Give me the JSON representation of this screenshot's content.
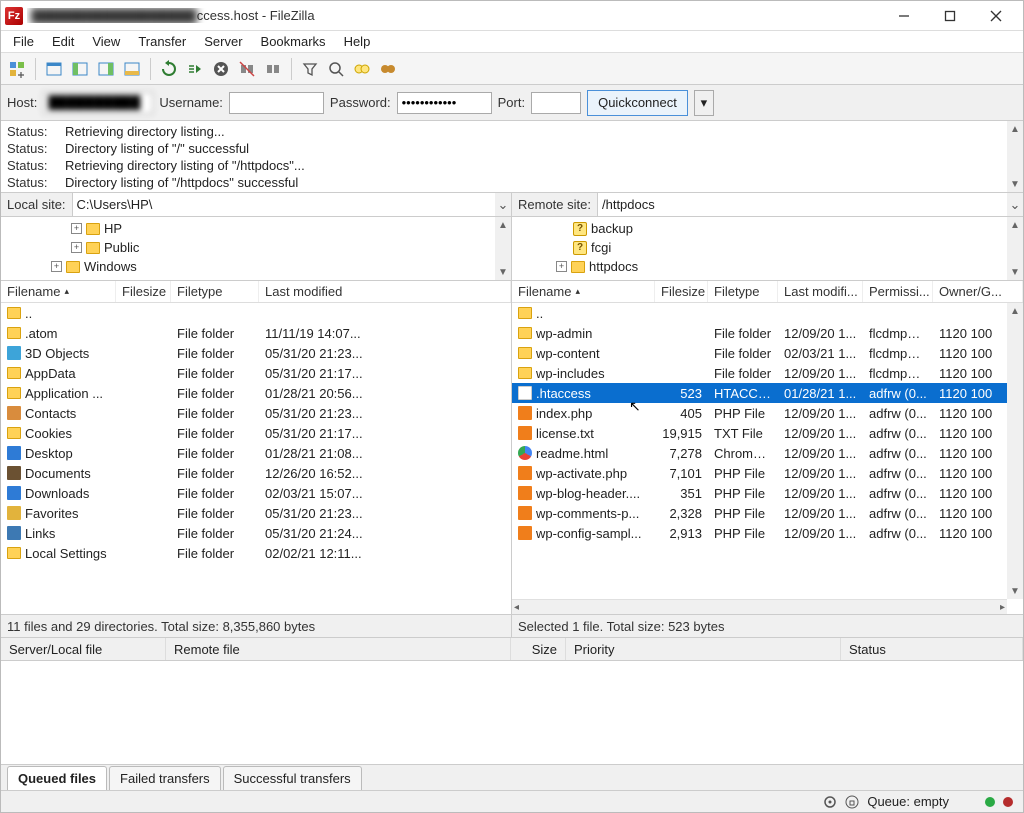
{
  "title": {
    "obscured": "██████████████████",
    "suffix": "ccess.host - FileZilla"
  },
  "menu": [
    "File",
    "Edit",
    "View",
    "Transfer",
    "Server",
    "Bookmarks",
    "Help"
  ],
  "quick": {
    "host_label": "Host:",
    "host_value": "██████████",
    "user_label": "Username:",
    "user_value": "",
    "pass_label": "Password:",
    "pass_value": "••••••••••••",
    "port_label": "Port:",
    "port_value": "",
    "connect": "Quickconnect"
  },
  "log": [
    {
      "k": "Status:",
      "t": "Retrieving directory listing..."
    },
    {
      "k": "Status:",
      "t": "Directory listing of \"/\" successful"
    },
    {
      "k": "Status:",
      "t": "Retrieving directory listing of \"/httpdocs\"..."
    },
    {
      "k": "Status:",
      "t": "Directory listing of \"/httpdocs\" successful"
    }
  ],
  "local": {
    "site_label": "Local site:",
    "site_value": "C:\\Users\\HP\\",
    "tree": [
      "HP",
      "Public",
      "Windows"
    ],
    "headers": {
      "name": "Filename",
      "size": "Filesize",
      "type": "Filetype",
      "mod": "Last modified"
    },
    "rows": [
      {
        "icon": "folder",
        "name": "..",
        "size": "",
        "type": "",
        "mod": ""
      },
      {
        "icon": "folder",
        "name": ".atom",
        "size": "",
        "type": "File folder",
        "mod": "11/11/19 14:07..."
      },
      {
        "icon": "obj3d",
        "name": "3D Objects",
        "size": "",
        "type": "File folder",
        "mod": "05/31/20 21:23..."
      },
      {
        "icon": "folder",
        "name": "AppData",
        "size": "",
        "type": "File folder",
        "mod": "05/31/20 21:17..."
      },
      {
        "icon": "folder",
        "name": "Application ...",
        "size": "",
        "type": "File folder",
        "mod": "01/28/21 20:56..."
      },
      {
        "icon": "contacts",
        "name": "Contacts",
        "size": "",
        "type": "File folder",
        "mod": "05/31/20 21:23..."
      },
      {
        "icon": "folder",
        "name": "Cookies",
        "size": "",
        "type": "File folder",
        "mod": "05/31/20 21:17..."
      },
      {
        "icon": "desktop",
        "name": "Desktop",
        "size": "",
        "type": "File folder",
        "mod": "01/28/21 21:08..."
      },
      {
        "icon": "docs",
        "name": "Documents",
        "size": "",
        "type": "File folder",
        "mod": "12/26/20 16:52..."
      },
      {
        "icon": "downloads",
        "name": "Downloads",
        "size": "",
        "type": "File folder",
        "mod": "02/03/21 15:07..."
      },
      {
        "icon": "fav",
        "name": "Favorites",
        "size": "",
        "type": "File folder",
        "mod": "05/31/20 21:23..."
      },
      {
        "icon": "links",
        "name": "Links",
        "size": "",
        "type": "File folder",
        "mod": "05/31/20 21:24..."
      },
      {
        "icon": "folder",
        "name": "Local Settings",
        "size": "",
        "type": "File folder",
        "mod": "02/02/21 12:11..."
      }
    ],
    "status": "11 files and 29 directories. Total size: 8,355,860 bytes"
  },
  "remote": {
    "site_label": "Remote site:",
    "site_value": "/httpdocs",
    "tree": [
      {
        "icon": "q",
        "name": "backup",
        "expander": ""
      },
      {
        "icon": "q",
        "name": "fcgi",
        "expander": ""
      },
      {
        "icon": "folder",
        "name": "httpdocs",
        "expander": "+"
      }
    ],
    "headers": {
      "name": "Filename",
      "size": "Filesize",
      "type": "Filetype",
      "mod": "Last modifi...",
      "perm": "Permissi...",
      "owner": "Owner/G..."
    },
    "rows": [
      {
        "icon": "folder",
        "name": "..",
        "size": "",
        "type": "",
        "mod": "",
        "perm": "",
        "owner": "",
        "sel": false
      },
      {
        "icon": "folder",
        "name": "wp-admin",
        "size": "",
        "type": "File folder",
        "mod": "12/09/20 1...",
        "perm": "flcdmpe ...",
        "owner": "1120 100",
        "sel": false
      },
      {
        "icon": "folder",
        "name": "wp-content",
        "size": "",
        "type": "File folder",
        "mod": "02/03/21 1...",
        "perm": "flcdmpe ...",
        "owner": "1120 100",
        "sel": false
      },
      {
        "icon": "folder",
        "name": "wp-includes",
        "size": "",
        "type": "File folder",
        "mod": "12/09/20 1...",
        "perm": "flcdmpe ...",
        "owner": "1120 100",
        "sel": false
      },
      {
        "icon": "file",
        "name": ".htaccess",
        "size": "523",
        "type": "HTACCE...",
        "mod": "01/28/21 1...",
        "perm": "adfrw (0...",
        "owner": "1120 100",
        "sel": true
      },
      {
        "icon": "php",
        "name": "index.php",
        "size": "405",
        "type": "PHP File",
        "mod": "12/09/20 1...",
        "perm": "adfrw (0...",
        "owner": "1120 100",
        "sel": false
      },
      {
        "icon": "php",
        "name": "license.txt",
        "size": "19,915",
        "type": "TXT File",
        "mod": "12/09/20 1...",
        "perm": "adfrw (0...",
        "owner": "1120 100",
        "sel": false
      },
      {
        "icon": "chrome",
        "name": "readme.html",
        "size": "7,278",
        "type": "Chrome ...",
        "mod": "12/09/20 1...",
        "perm": "adfrw (0...",
        "owner": "1120 100",
        "sel": false
      },
      {
        "icon": "php",
        "name": "wp-activate.php",
        "size": "7,101",
        "type": "PHP File",
        "mod": "12/09/20 1...",
        "perm": "adfrw (0...",
        "owner": "1120 100",
        "sel": false
      },
      {
        "icon": "php",
        "name": "wp-blog-header....",
        "size": "351",
        "type": "PHP File",
        "mod": "12/09/20 1...",
        "perm": "adfrw (0...",
        "owner": "1120 100",
        "sel": false
      },
      {
        "icon": "php",
        "name": "wp-comments-p...",
        "size": "2,328",
        "type": "PHP File",
        "mod": "12/09/20 1...",
        "perm": "adfrw (0...",
        "owner": "1120 100",
        "sel": false
      },
      {
        "icon": "php",
        "name": "wp-config-sampl...",
        "size": "2,913",
        "type": "PHP File",
        "mod": "12/09/20 1...",
        "perm": "adfrw (0...",
        "owner": "1120 100",
        "sel": false
      }
    ],
    "status": "Selected 1 file. Total size: 523 bytes"
  },
  "queue": {
    "headers": {
      "local": "Server/Local file",
      "remote": "Remote file",
      "size": "Size",
      "priority": "Priority",
      "status": "Status"
    },
    "tabs": [
      "Queued files",
      "Failed transfers",
      "Successful transfers"
    ],
    "active_tab": 0
  },
  "footer": {
    "queue": "Queue: empty"
  }
}
